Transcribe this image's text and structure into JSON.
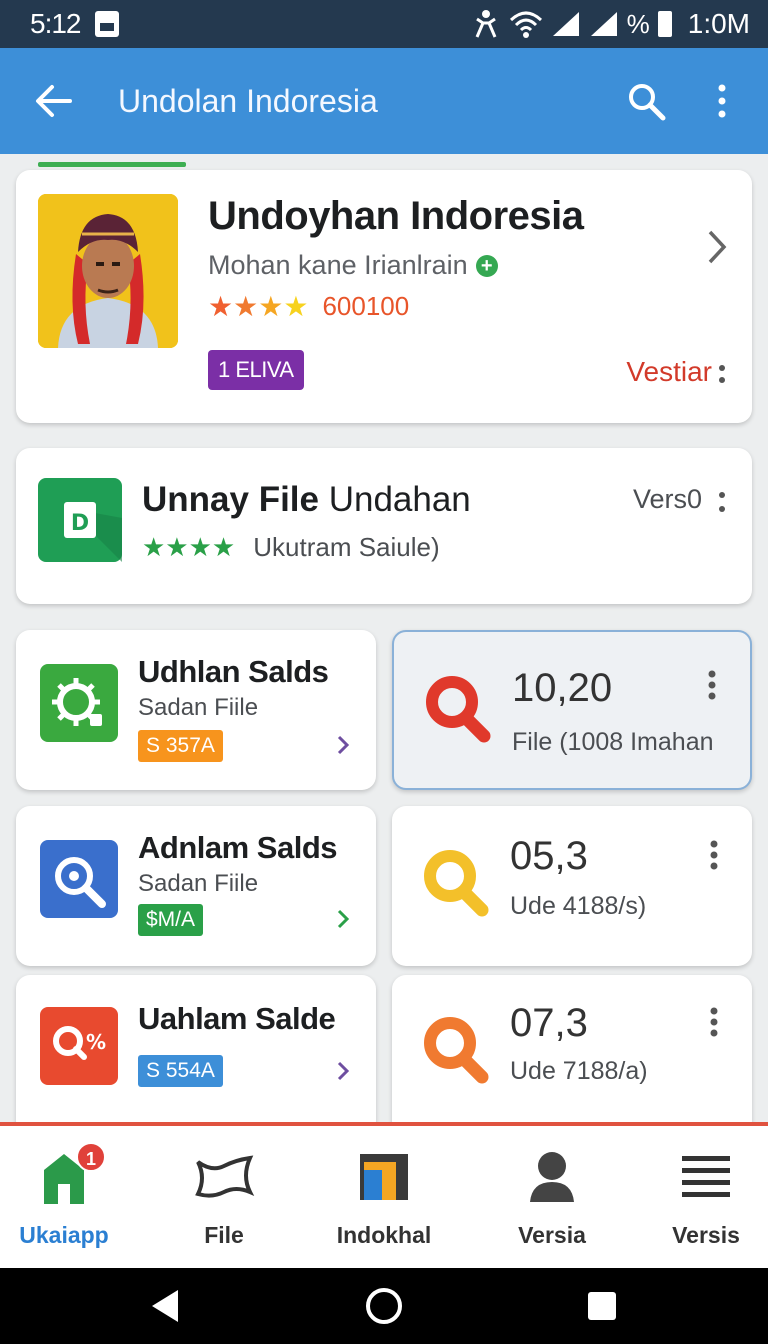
{
  "status_bar": {
    "time": "5:12",
    "battery": "%",
    "clock": "1:0M"
  },
  "app_bar": {
    "title": "Undolan Indoresia"
  },
  "featured": {
    "title": "Undoyhan Indoresia",
    "subtitle": "Mohan kane Irianlrain",
    "rating_count": "600100",
    "badge": "1 ELIVA",
    "action": "Vestiar"
  },
  "file_card": {
    "title_bold": "Unnay File",
    "title_rest": " Undahan",
    "subtitle": "Ukutram Saiule)",
    "version": "Vers0",
    "icon_letter": "D"
  },
  "tiles": [
    {
      "title": "Udhlan Salds",
      "subtitle": "Sadan Fiile",
      "chip": "S 357A",
      "chip_color": "#f7941d",
      "icon_color": "#3aa93f",
      "chevron_color": "#6e4ea0"
    },
    {
      "title": "Adnlam Salds",
      "subtitle": "Sadan Fiile",
      "chip": "$M/A",
      "chip_color": "#2aa048",
      "icon_color": "#3a6fcc",
      "chevron_color": "#2aa048"
    },
    {
      "title": "Uahlam Salde",
      "subtitle": "",
      "chip": "S 554A",
      "chip_color": "#3d8fd8",
      "icon_color": "#e84a2f",
      "icon_symbol": "%",
      "chevron_color": "#6e4ea0"
    }
  ],
  "stats": [
    {
      "value": "10,20",
      "subtitle": "File (1008 Imahan",
      "color": "#e0392b"
    },
    {
      "value": "05,3",
      "subtitle": "Ude 4188/s)",
      "color": "#f3c02a"
    },
    {
      "value": "07,3",
      "subtitle": "Ude 7188/a)",
      "color": "#f07a30"
    }
  ],
  "bottom_nav": [
    {
      "label": "Ukaiapp",
      "icon": "home-icon",
      "badge": "1",
      "active": true
    },
    {
      "label": "File",
      "icon": "file-icon"
    },
    {
      "label": "Indokhal",
      "icon": "indokhal-icon"
    },
    {
      "label": "Versia",
      "icon": "profile-icon"
    },
    {
      "label": "Versis",
      "icon": "menu-icon"
    }
  ],
  "colors": {
    "app_bar": "#3d8fd8",
    "status_bar": "#24394f",
    "accent_red": "#e0523f"
  }
}
